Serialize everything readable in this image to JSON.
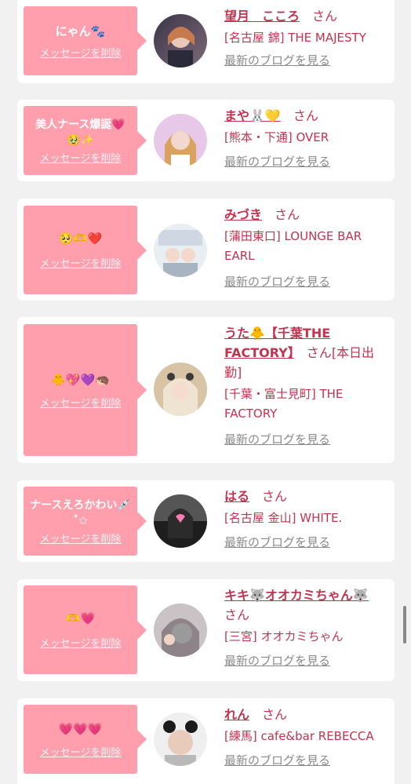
{
  "entries": [
    {
      "message": "にゃん🐾",
      "delete_label": "メッセージを削除",
      "name": "望月　こころ",
      "san": "さん",
      "shop": "[名古屋 錦] THE MAJESTY",
      "blog_label": "最新のブログを見る",
      "avatar_colors": [
        "#3b3548",
        "#7c6a78"
      ]
    },
    {
      "message": "美人ナース爆誕💗🥹✨",
      "delete_label": "メッセージを削除",
      "name": "まや🐰💛",
      "san": "さん",
      "shop": "[熊本・下通] OVER",
      "blog_label": "最新のブログを見る",
      "avatar_colors": [
        "#e7c8e8",
        "#d9a35f"
      ]
    },
    {
      "message": "🥺🫶❤️",
      "delete_label": "メッセージを削除",
      "name": "みづき",
      "san": "さん",
      "shop": "[蒲田東口] LOUNGE BAR EARL",
      "blog_label": "最新のブログを見る",
      "avatar_colors": [
        "#e9eef3",
        "#a9b4c2"
      ]
    },
    {
      "message": "🐥💖💜🦔",
      "delete_label": "メッセージを削除",
      "name": "うた🐥【千葉THE FACTORY】",
      "san": "さん",
      "name_suffix": "[本日出勤]",
      "shop": "[千葉・富士見町] THE FACTORY",
      "blog_label": "最新のブログを見る",
      "avatar_colors": [
        "#d8c3a4",
        "#efe4d2"
      ]
    },
    {
      "message": "ナースえろかわい💉˚✩",
      "delete_label": "メッセージを削除",
      "name": "はる",
      "san": "さん",
      "shop": "[名古屋 金山] WHITE.",
      "blog_label": "最新のブログを見る",
      "avatar_colors": [
        "#1e1e1e",
        "#555555"
      ]
    },
    {
      "message": "🫶💗",
      "delete_label": "メッセージを削除",
      "name": "キキ🐺オオカミちゃん🐺",
      "san": "さん",
      "shop": "[三宮] オオカミちゃん",
      "blog_label": "最新のブログを見る",
      "avatar_colors": [
        "#c9c3c5",
        "#8d8388"
      ]
    },
    {
      "message": "💗💗💗",
      "delete_label": "メッセージを削除",
      "name": "れん",
      "san": "さん",
      "shop": "[練馬] cafe&bar REBECCA",
      "blog_label": "最新のブログを見る",
      "avatar_colors": [
        "#efefef",
        "#b9b9b9"
      ]
    }
  ]
}
